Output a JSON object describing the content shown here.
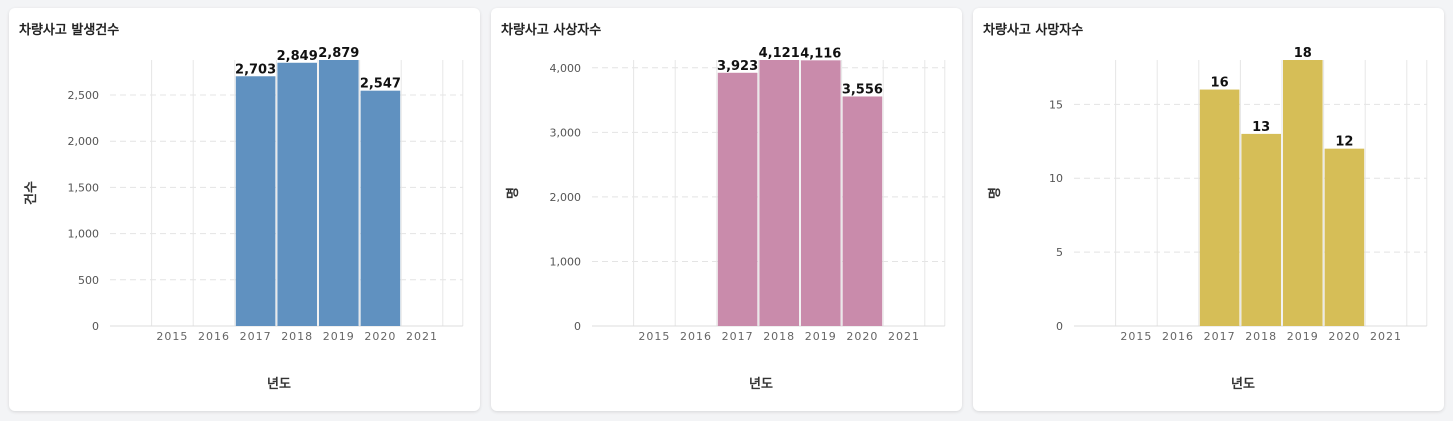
{
  "chart_data": [
    {
      "type": "bar",
      "title": "차량사고 발생건수",
      "xlabel": "년도",
      "ylabel": "건수",
      "categories": [
        "2015",
        "2016",
        "2017",
        "2018",
        "2019",
        "2020",
        "2021"
      ],
      "values": [
        null,
        null,
        2703,
        2849,
        2879,
        2547,
        null
      ],
      "value_labels": [
        "",
        "",
        "2,703",
        "2,849",
        "2,879",
        "2,547",
        ""
      ],
      "yticks": [
        0,
        500,
        1000,
        1500,
        2000,
        2500
      ],
      "ytick_labels": [
        "0",
        "500",
        "1,000",
        "1,500",
        "2,000",
        "2,500"
      ],
      "ylim": [
        0,
        2879
      ],
      "color": "#6091c0",
      "grid": true
    },
    {
      "type": "bar",
      "title": "차량사고 사상자수",
      "xlabel": "년도",
      "ylabel": "명",
      "categories": [
        "2015",
        "2016",
        "2017",
        "2018",
        "2019",
        "2020",
        "2021"
      ],
      "values": [
        null,
        null,
        3923,
        4121,
        4116,
        3556,
        null
      ],
      "value_labels": [
        "",
        "",
        "3,923",
        "4,121",
        "4,116",
        "3,556",
        ""
      ],
      "yticks": [
        0,
        1000,
        2000,
        3000,
        4000
      ],
      "ytick_labels": [
        "0",
        "1,000",
        "2,000",
        "3,000",
        "4,000"
      ],
      "ylim": [
        0,
        4121
      ],
      "color": "#c98bab",
      "grid": true
    },
    {
      "type": "bar",
      "title": "차량사고 사망자수",
      "xlabel": "년도",
      "ylabel": "명",
      "categories": [
        "2015",
        "2016",
        "2017",
        "2018",
        "2019",
        "2020",
        "2021"
      ],
      "values": [
        null,
        null,
        16,
        13,
        18,
        12,
        null
      ],
      "value_labels": [
        "",
        "",
        "16",
        "13",
        "18",
        "12",
        ""
      ],
      "yticks": [
        0,
        5,
        10,
        15
      ],
      "ytick_labels": [
        "0",
        "5",
        "10",
        "15"
      ],
      "ylim": [
        0,
        18
      ],
      "color": "#d6be57",
      "grid": true
    }
  ]
}
